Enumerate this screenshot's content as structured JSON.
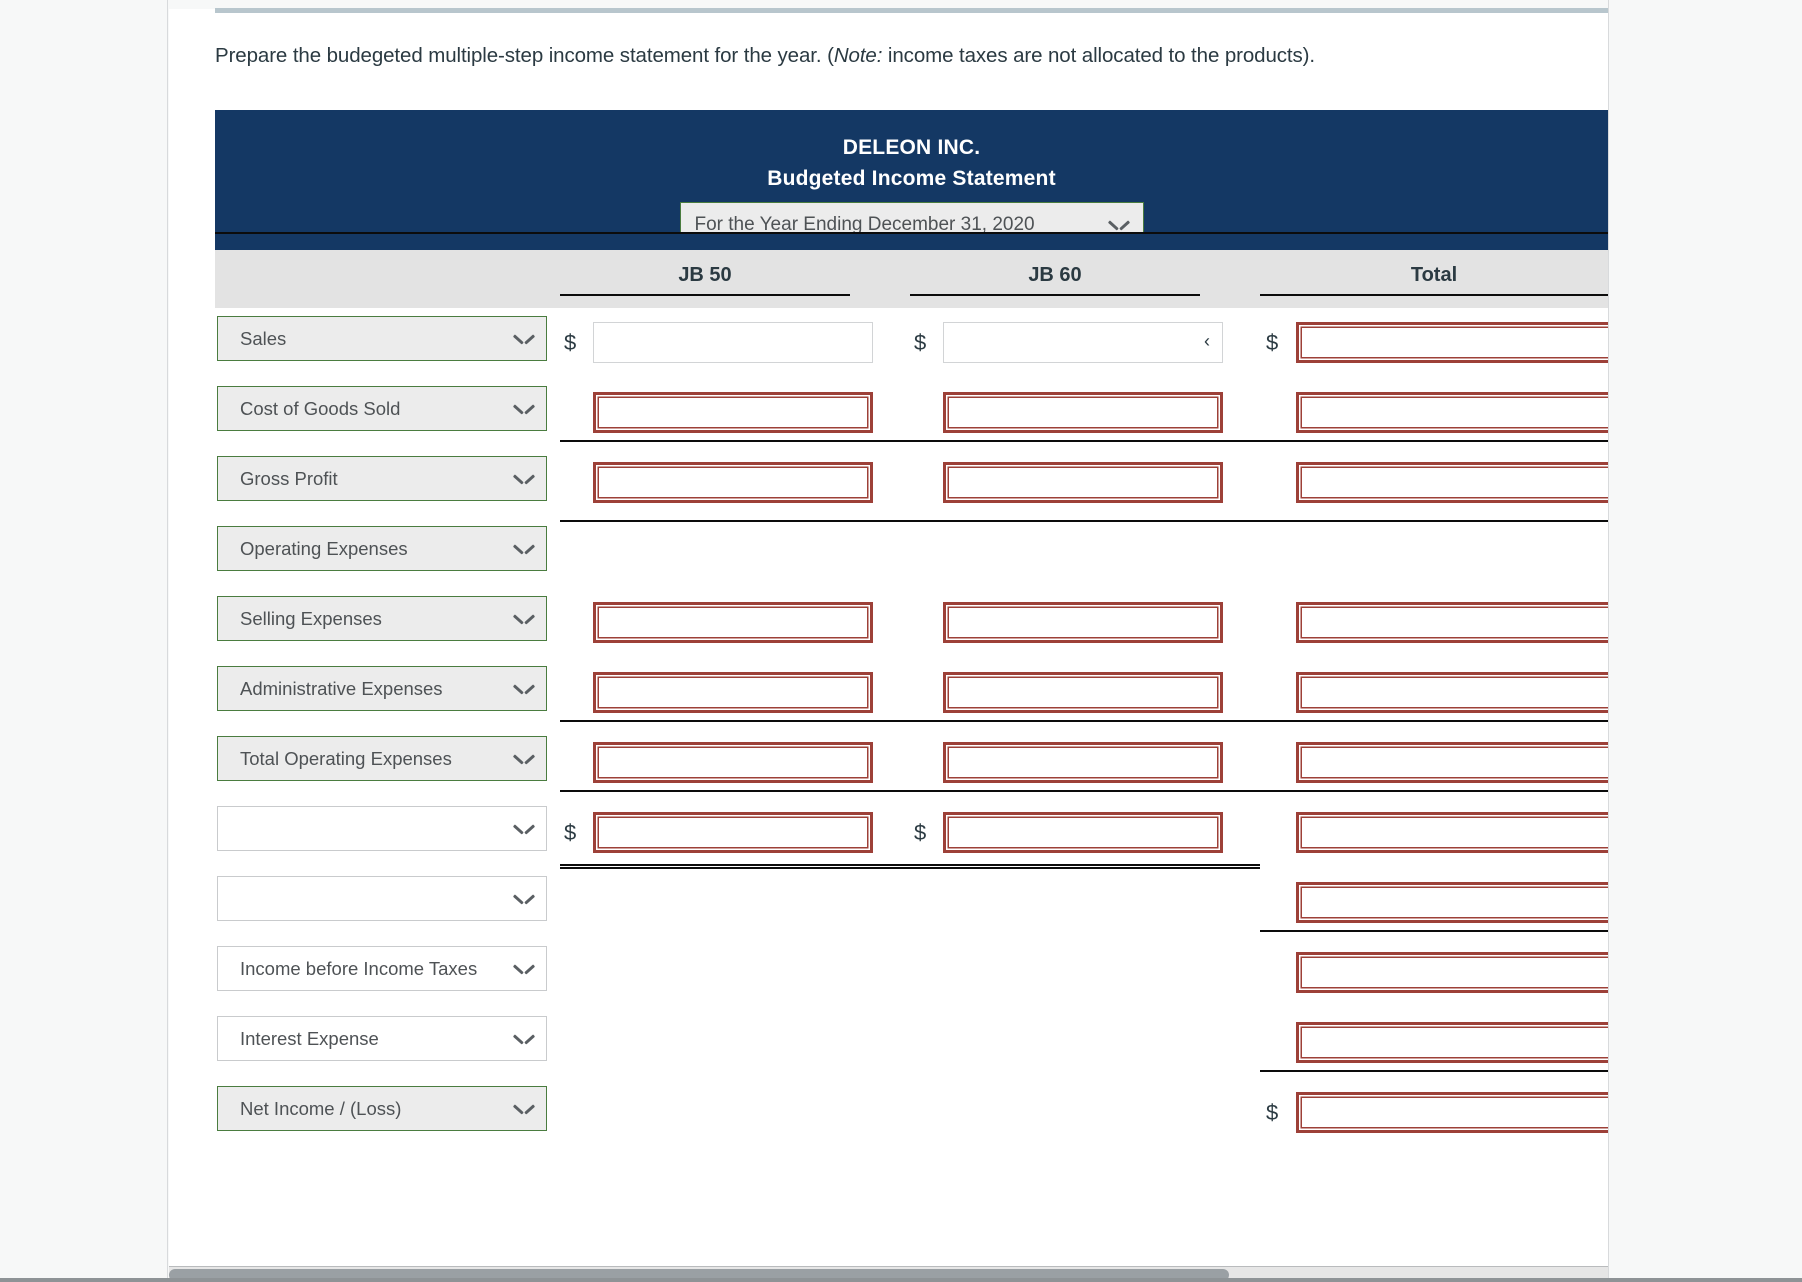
{
  "prompt": {
    "text_before": "Prepare the budegeted multiple-step income statement for the year. (",
    "note_italic": "Note:",
    "text_after": " income taxes are not allocated to the products)."
  },
  "statement": {
    "company": "DELEON INC.",
    "title": "Budgeted Income Statement",
    "period": {
      "value": "For the Year Ending December 31, 2020",
      "options": [
        "For the Year Ending December 31, 2020"
      ]
    },
    "columns": {
      "col1": "JB 50",
      "col2": "JB 60",
      "col3": "Total"
    },
    "currency_symbol": "$",
    "caret_glyph": "‹",
    "rows": [
      {
        "label": "Sales",
        "style": "filled"
      },
      {
        "label": "Cost of Goods Sold",
        "style": "filled"
      },
      {
        "label": "Gross Profit",
        "style": "filled"
      },
      {
        "label": "Operating Expenses",
        "style": "filled"
      },
      {
        "label": "Selling Expenses",
        "style": "filled"
      },
      {
        "label": "Administrative Expenses",
        "style": "filled"
      },
      {
        "label": "Total Operating Expenses",
        "style": "filled"
      },
      {
        "label": "",
        "style": "plain"
      },
      {
        "label": "",
        "style": "plain"
      },
      {
        "label": "Income before Income Taxes",
        "style": "plain"
      },
      {
        "label": "Interest Expense",
        "style": "plain"
      },
      {
        "label": "Net Income / (Loss)",
        "style": "filled"
      }
    ],
    "input_values": {
      "sales_jb50": "",
      "sales_jb60": "",
      "sales_total": "",
      "cogs_jb50": "",
      "cogs_jb60": "",
      "cogs_total": "",
      "gross_profit_jb50": "",
      "gross_profit_jb60": "",
      "gross_profit_total": "",
      "selling_jb50": "",
      "selling_jb60": "",
      "selling_total": "",
      "admin_jb50": "",
      "admin_jb60": "",
      "admin_total": "",
      "total_opex_jb50": "",
      "total_opex_jb60": "",
      "total_opex_total": "",
      "row8_jb50": "",
      "row8_jb60": "",
      "row8_total": "",
      "row9_total": "",
      "income_before_taxes_total": "",
      "interest_expense_total": "",
      "net_income_total": ""
    }
  },
  "colors": {
    "header_blue": "#143864",
    "column_band": "#e3e3e3",
    "select_fill": "#ececec",
    "select_border_green": "#4a7c3f",
    "input_error_red": "#9d4038",
    "rule_black": "#0c0c0c",
    "page_background": "#f7f8f8"
  }
}
